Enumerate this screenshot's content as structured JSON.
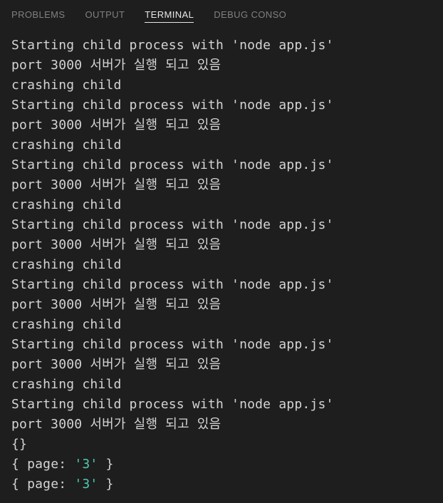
{
  "tabs": {
    "problems": "PROBLEMS",
    "output": "OUTPUT",
    "terminal": "TERMINAL",
    "debug_console": "DEBUG CONSO"
  },
  "terminal": {
    "lines": [
      {
        "type": "plain",
        "text": "Starting child process with 'node app.js'"
      },
      {
        "type": "plain",
        "text": "port 3000 서버가 실행 되고 있음"
      },
      {
        "type": "plain",
        "text": "crashing child"
      },
      {
        "type": "plain",
        "text": "Starting child process with 'node app.js'"
      },
      {
        "type": "plain",
        "text": "port 3000 서버가 실행 되고 있음"
      },
      {
        "type": "plain",
        "text": "crashing child"
      },
      {
        "type": "plain",
        "text": "Starting child process with 'node app.js'"
      },
      {
        "type": "plain",
        "text": "port 3000 서버가 실행 되고 있음"
      },
      {
        "type": "plain",
        "text": "crashing child"
      },
      {
        "type": "plain",
        "text": "Starting child process with 'node app.js'"
      },
      {
        "type": "plain",
        "text": "port 3000 서버가 실행 되고 있음"
      },
      {
        "type": "plain",
        "text": "crashing child"
      },
      {
        "type": "plain",
        "text": "Starting child process with 'node app.js'"
      },
      {
        "type": "plain",
        "text": "port 3000 서버가 실행 되고 있음"
      },
      {
        "type": "plain",
        "text": "crashing child"
      },
      {
        "type": "plain",
        "text": "Starting child process with 'node app.js'"
      },
      {
        "type": "plain",
        "text": "port 3000 서버가 실행 되고 있음"
      },
      {
        "type": "plain",
        "text": "crashing child"
      },
      {
        "type": "plain",
        "text": "Starting child process with 'node app.js'"
      },
      {
        "type": "plain",
        "text": "port 3000 서버가 실행 되고 있음"
      },
      {
        "type": "plain",
        "text": "{}"
      },
      {
        "type": "object",
        "open": "{ ",
        "key": "page",
        "colon": ": ",
        "value": "'3'",
        "close": " }"
      },
      {
        "type": "object",
        "open": "{ ",
        "key": "page",
        "colon": ": ",
        "value": "'3'",
        "close": " }"
      }
    ]
  }
}
